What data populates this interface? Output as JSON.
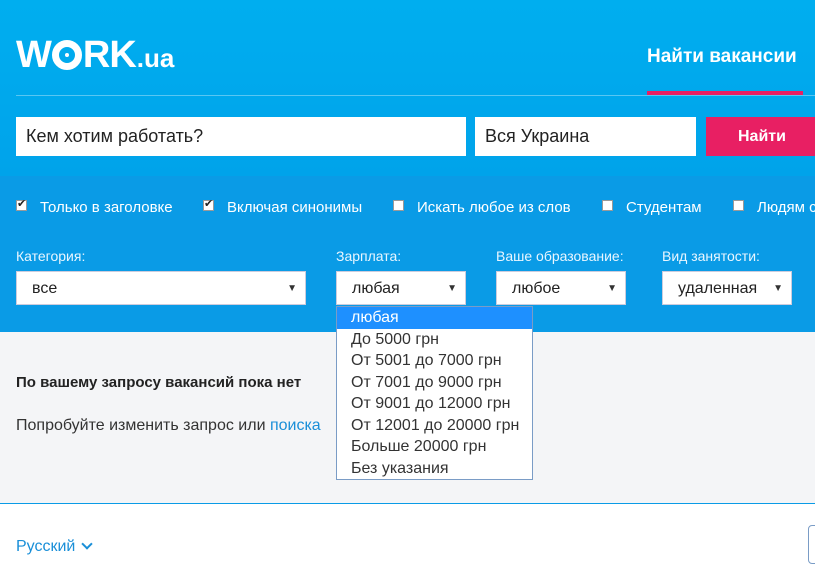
{
  "brand": {
    "logo_w": "W",
    "logo_rest": "RK",
    "logo_tld": ".ua"
  },
  "nav": {
    "find_jobs": "Найти вакансии"
  },
  "search": {
    "query_value": "Кем хотим работать?",
    "region_value": "Вся Украина",
    "find_label": "Найти"
  },
  "checkboxes": [
    {
      "label": "Только в заголовке",
      "checked": true
    },
    {
      "label": "Включая синонимы",
      "checked": true
    },
    {
      "label": "Искать любое из слов",
      "checked": false
    },
    {
      "label": "Студентам",
      "checked": false
    },
    {
      "label": "Людям с",
      "checked": false
    }
  ],
  "filters": {
    "category": {
      "label": "Категория:",
      "value": "все"
    },
    "salary": {
      "label": "Зарплата:",
      "value": "любая"
    },
    "education": {
      "label": "Ваше образование:",
      "value": "любое"
    },
    "employment": {
      "label": "Вид занятости:",
      "value": "удаленная"
    }
  },
  "salary_dropdown": {
    "options": [
      "любая",
      "До 5000 грн",
      "От 5001 до 7000 грн",
      "От 7001 до 9000 грн",
      "От 9001 до 12000 грн",
      "От 12001 до 20000 грн",
      "Больше 20000 грн",
      "Без указания"
    ],
    "selected_index": 0
  },
  "results": {
    "empty_title": "По вашему запросу вакансий пока нет",
    "hint_prefix": "Попробуйте изменить запрос или ",
    "hint_link": "поиска"
  },
  "footer": {
    "language": "Русский"
  },
  "colors": {
    "primary": "#00aeef",
    "accent": "#e81f63",
    "link": "#1a8fd8"
  }
}
